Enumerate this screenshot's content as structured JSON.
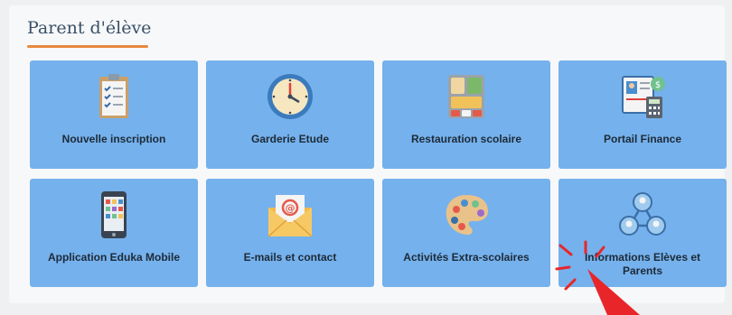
{
  "section": {
    "title": "Parent d'élève"
  },
  "tiles": [
    {
      "label": "Nouvelle inscription",
      "icon": "clipboard-checklist-icon"
    },
    {
      "label": "Garderie Etude",
      "icon": "clock-icon"
    },
    {
      "label": "Restauration scolaire",
      "icon": "lunch-tray-icon"
    },
    {
      "label": "Portail Finance",
      "icon": "finance-id-calculator-icon"
    },
    {
      "label": "Application Eduka Mobile",
      "icon": "smartphone-apps-icon"
    },
    {
      "label": "E-mails et contact",
      "icon": "email-envelope-icon"
    },
    {
      "label": "Activités Extra-scolaires",
      "icon": "paint-palette-icon"
    },
    {
      "label": "Informations Elèves et Parents",
      "icon": "people-network-icon"
    }
  ],
  "colors": {
    "tile": "#75b1ec",
    "accent": "#e7893d",
    "title": "#3a5068",
    "cursor": "#e8262a"
  }
}
